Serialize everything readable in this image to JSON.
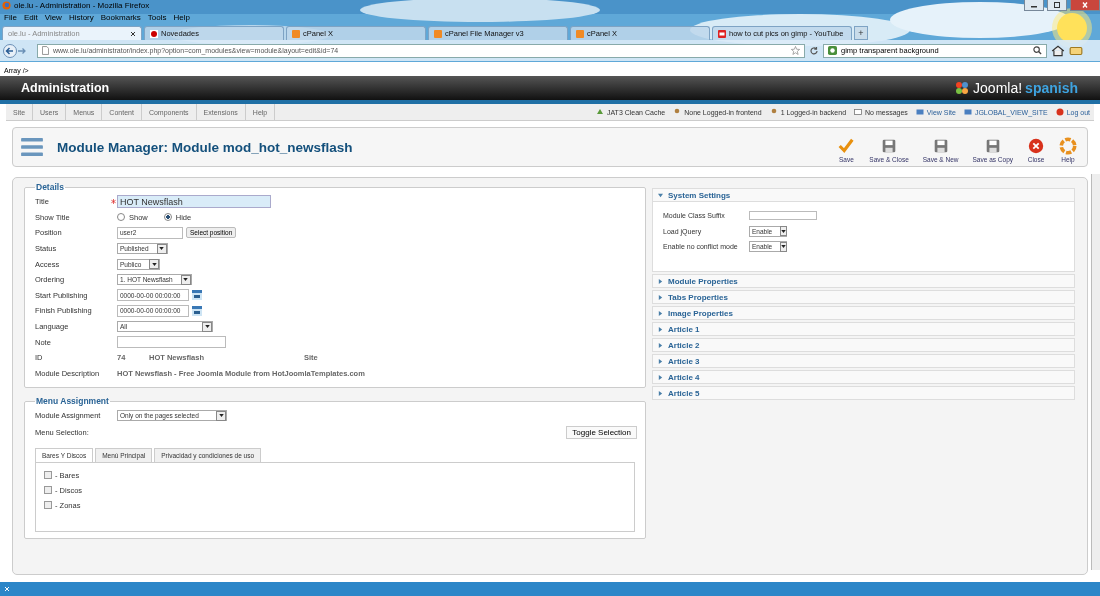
{
  "browser": {
    "title": "ole.lu - Administration - Mozilla Firefox",
    "menu": [
      "File",
      "Edit",
      "View",
      "History",
      "Bookmarks",
      "Tools",
      "Help"
    ],
    "tabs": [
      {
        "label": "ole.lu - Administration",
        "selected": true,
        "kind": "page"
      },
      {
        "label": "Novedades",
        "selected": false,
        "kind": "red"
      },
      {
        "label": "cPanel X",
        "selected": false,
        "kind": "cp"
      },
      {
        "label": "cPanel File Manager v3",
        "selected": false,
        "kind": "cp"
      },
      {
        "label": "cPanel X",
        "selected": false,
        "kind": "cp"
      },
      {
        "label": "how to cut pics on gimp - YouTube",
        "selected": false,
        "kind": "yt"
      }
    ],
    "new_tab": "+",
    "url": "www.ole.lu/administrator/index.php?option=com_modules&view=module&layout=edit&id=74",
    "search": "gimp transparent background"
  },
  "page_notice": "Array />",
  "admin": {
    "title": "Administration",
    "logo": "Joomla!",
    "logo_tag": "spanish"
  },
  "nav": [
    "Site",
    "Users",
    "Menus",
    "Content",
    "Components",
    "Extensions",
    "Help"
  ],
  "status": [
    {
      "label": "JAT3 Clean Cache",
      "kind": "cache"
    },
    {
      "label": "None Logged-in frontend",
      "kind": "frontend"
    },
    {
      "label": "1 Logged-in backend",
      "kind": "backend"
    },
    {
      "label": "No messages",
      "kind": "messages"
    },
    {
      "label": "View Site",
      "kind": "site"
    },
    {
      "label": "JGLOBAL_VIEW_SITE",
      "kind": "site"
    },
    {
      "label": "Log out",
      "kind": "logout"
    }
  ],
  "toolbar": {
    "title": "Module Manager: Module mod_hot_newsflash",
    "buttons": [
      {
        "label": "Save",
        "kind": "save"
      },
      {
        "label": "Save & Close",
        "kind": "floppy"
      },
      {
        "label": "Save & New",
        "kind": "floppy"
      },
      {
        "label": "Save as Copy",
        "kind": "floppy"
      },
      {
        "label": "Close",
        "kind": "close"
      },
      {
        "label": "Help",
        "kind": "help"
      }
    ]
  },
  "details": {
    "legend": "Details",
    "fields": [
      {
        "label": "Title",
        "required": true,
        "kind": "title",
        "value": "HOT Newsflash"
      },
      {
        "label": "Show Title",
        "required": false,
        "kind": "radio",
        "options": [
          {
            "label": "Show",
            "selected": false
          },
          {
            "label": "Hide",
            "selected": true
          }
        ]
      },
      {
        "label": "Position",
        "required": false,
        "kind": "position",
        "value": "user2",
        "button": "Select position"
      },
      {
        "label": "Status",
        "required": false,
        "kind": "select",
        "value": "Published"
      },
      {
        "label": "Access",
        "required": false,
        "kind": "select",
        "value": "Publico"
      },
      {
        "label": "Ordering",
        "required": false,
        "kind": "select",
        "value": "1. HOT Newsflash"
      },
      {
        "label": "Start Publishing",
        "required": false,
        "kind": "date",
        "value": "0000-00-00 00:00:00"
      },
      {
        "label": "Finish Publishing",
        "required": false,
        "kind": "date",
        "value": "0000-00-00 00:00:00"
      },
      {
        "label": "Language",
        "required": false,
        "kind": "select_wide",
        "value": "All"
      },
      {
        "label": "Note",
        "required": false,
        "kind": "text"
      },
      {
        "label": "ID",
        "required": false,
        "kind": "info",
        "parts": [
          "74",
          "HOT Newsflash",
          "Site"
        ]
      },
      {
        "label": "Module Description",
        "required": false,
        "kind": "description",
        "value": "HOT Newsflash - Free Joomla Module from HotJoomlaTemplates.com"
      }
    ]
  },
  "system_settings": {
    "title": "System Settings",
    "expanded": true,
    "fields": [
      {
        "label": "Module Class Suffix",
        "kind": "text"
      },
      {
        "label": "Load jQuery",
        "kind": "select",
        "value": "Enable"
      },
      {
        "label": "Enable no conflict mode",
        "kind": "select",
        "value": "Enable"
      }
    ]
  },
  "panels": [
    {
      "title": "Module Properties",
      "expanded": false
    },
    {
      "title": "Tabs Properties",
      "expanded": false
    },
    {
      "title": "Image Properties",
      "expanded": false
    },
    {
      "title": "Article 1",
      "expanded": false
    },
    {
      "title": "Article 2",
      "expanded": false
    },
    {
      "title": "Article 3",
      "expanded": false
    },
    {
      "title": "Article 4",
      "expanded": false
    },
    {
      "title": "Article 5",
      "expanded": false
    }
  ],
  "menu_assignment": {
    "legend": "Menu Assignment",
    "assignment_label": "Module Assignment",
    "assignment_value": "Only on the pages selected",
    "selection_label": "Menu Selection:",
    "toggle": "Toggle Selection",
    "tabs": [
      {
        "label": "Bares Y Discos",
        "selected": true
      },
      {
        "label": "Menú Principal",
        "selected": false
      },
      {
        "label": "Privacidad y condiciones de uso",
        "selected": false
      }
    ],
    "items": [
      {
        "label": "- Bares",
        "checked": false
      },
      {
        "label": "- Discos",
        "checked": false
      },
      {
        "label": "- Zonas",
        "checked": false
      }
    ]
  }
}
